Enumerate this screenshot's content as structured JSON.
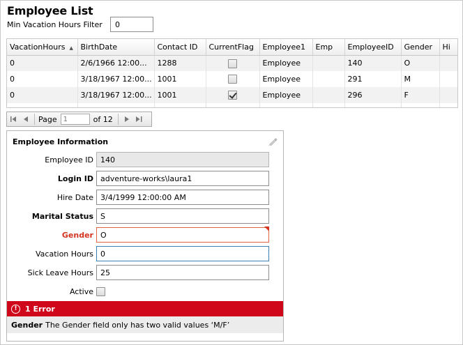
{
  "page": {
    "title": "Employee List",
    "filter_label": "Min Vacation Hours Filter",
    "filter_value": "0"
  },
  "grid": {
    "columns": [
      "VacationHours",
      "BirthDate",
      "Contact ID",
      "CurrentFlag",
      "Employee1",
      "Emp",
      "EmployeeID",
      "Gender",
      "Hi"
    ],
    "sort_column": "VacationHours",
    "rows": [
      {
        "VacationHours": "0",
        "BirthDate": "2/6/1966 12:00...",
        "ContactID": "1288",
        "CurrentFlag": false,
        "Employee1": "Employee",
        "Emp": "",
        "EmployeeID": "140",
        "Gender": "O",
        "Hi": ""
      },
      {
        "VacationHours": "0",
        "BirthDate": "3/18/1967 12:00...",
        "ContactID": "1001",
        "CurrentFlag": false,
        "Employee1": "Employee",
        "Emp": "",
        "EmployeeID": "291",
        "Gender": "M",
        "Hi": ""
      },
      {
        "VacationHours": "0",
        "BirthDate": "3/18/1967 12:00...",
        "ContactID": "1001",
        "CurrentFlag": true,
        "Employee1": "Employee",
        "Emp": "",
        "EmployeeID": "296",
        "Gender": "F",
        "Hi": ""
      }
    ]
  },
  "pager": {
    "page_label": "Page",
    "page_value": "1",
    "of_label": "of 12"
  },
  "form": {
    "title": "Employee Information",
    "fields": {
      "employee_id": {
        "label": "Employee ID",
        "value": "140"
      },
      "login_id": {
        "label": "Login ID",
        "value": "adventure-works\\laura1"
      },
      "hire_date": {
        "label": "Hire Date",
        "value": "3/4/1999 12:00:00 AM"
      },
      "marital_status": {
        "label": "Marital Status",
        "value": "S"
      },
      "gender": {
        "label": "Gender",
        "value": "O"
      },
      "vacation_hours": {
        "label": "Vacation Hours",
        "value": "0"
      },
      "sick_leave_hours": {
        "label": "Sick Leave Hours",
        "value": "25"
      },
      "active": {
        "label": "Active",
        "checked": false
      }
    },
    "errors": {
      "count_label": "1 Error",
      "icon_glyph": "!",
      "items": [
        {
          "field": "Gender",
          "message": "The Gender field only has two valid values ‘M/F’"
        }
      ]
    }
  },
  "colors": {
    "error_red": "#d0061a",
    "error_label": "#d4341f",
    "alt_row": "#f2f2f2"
  }
}
